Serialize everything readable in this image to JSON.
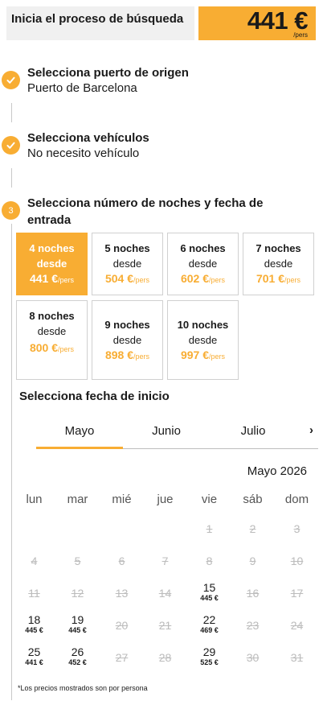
{
  "header": {
    "title": "Inicia el proceso de búsqueda",
    "price": "441 €",
    "price_unit": "/pers"
  },
  "steps": [
    {
      "number": "✓",
      "title": "Selecciona puerto de origen",
      "value": "Puerto de Barcelona"
    },
    {
      "number": "✓",
      "title": "Selecciona vehículos",
      "value": "No necesito vehículo"
    },
    {
      "number": "3",
      "title": "Selecciona número de noches y fecha de entrada"
    }
  ],
  "nights_label_from": "desde",
  "nights": [
    {
      "nights": "4 noches",
      "from": "desde",
      "price": "441 €",
      "unit": "/pers",
      "selected": true
    },
    {
      "nights": "5 noches",
      "from": "desde",
      "price": "504 €",
      "unit": "/pers"
    },
    {
      "nights": "6 noches",
      "from": "desde",
      "price": "602 €",
      "unit": "/pers"
    },
    {
      "nights": "7 noches",
      "from": "desde",
      "price": "701 €",
      "unit": "/pers"
    },
    {
      "nights": "8 noches",
      "from": "desde",
      "price": "800 €",
      "unit": "/pers"
    },
    {
      "nights": "9 noches",
      "from": "desde",
      "price": "898 €",
      "unit": "/pers"
    },
    {
      "nights": "10 noches",
      "from": "desde",
      "price": "997 €",
      "unit": "/pers"
    }
  ],
  "date_section_title": "Selecciona fecha de inicio",
  "month_tabs": [
    "Mayo",
    "Junio",
    "Julio"
  ],
  "active_month": "Mayo",
  "calendar_title": "Mayo 2026",
  "weekdays": [
    "lun",
    "mar",
    "mié",
    "jue",
    "vie",
    "sáb",
    "dom"
  ],
  "days": [
    {
      "d": "1",
      "available": false
    },
    {
      "d": "2",
      "available": false
    },
    {
      "d": "3",
      "available": false
    },
    {
      "d": "4",
      "available": false
    },
    {
      "d": "5",
      "available": false
    },
    {
      "d": "6",
      "available": false
    },
    {
      "d": "7",
      "available": false
    },
    {
      "d": "8",
      "available": false
    },
    {
      "d": "9",
      "available": false
    },
    {
      "d": "10",
      "available": false
    },
    {
      "d": "11",
      "available": false
    },
    {
      "d": "12",
      "available": false
    },
    {
      "d": "13",
      "available": false
    },
    {
      "d": "14",
      "available": false
    },
    {
      "d": "15",
      "available": true,
      "price": "445 €"
    },
    {
      "d": "16",
      "available": false
    },
    {
      "d": "17",
      "available": false
    },
    {
      "d": "18",
      "available": true,
      "price": "445 €"
    },
    {
      "d": "19",
      "available": true,
      "price": "445 €"
    },
    {
      "d": "20",
      "available": false
    },
    {
      "d": "21",
      "available": false
    },
    {
      "d": "22",
      "available": true,
      "price": "469 €"
    },
    {
      "d": "23",
      "available": false
    },
    {
      "d": "24",
      "available": false
    },
    {
      "d": "25",
      "available": true,
      "price": "441 €"
    },
    {
      "d": "26",
      "available": true,
      "price": "452 €"
    },
    {
      "d": "27",
      "available": false
    },
    {
      "d": "28",
      "available": false
    },
    {
      "d": "29",
      "available": true,
      "price": "525 €"
    },
    {
      "d": "30",
      "available": false
    },
    {
      "d": "31",
      "available": false
    }
  ],
  "footnote": "*Los precios mostrados son por persona",
  "colors": {
    "accent": "#f8ad33",
    "header_bg": "#f0f0f0",
    "disabled": "#bcbcbc"
  }
}
